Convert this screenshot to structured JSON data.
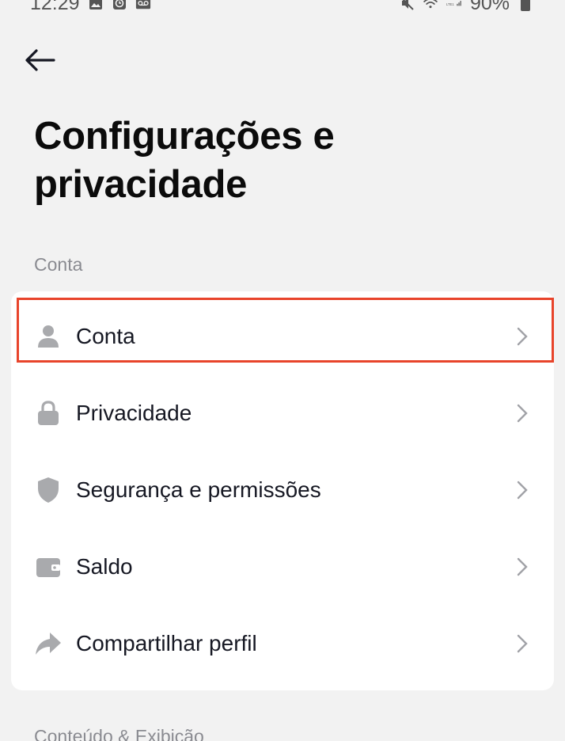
{
  "status_bar": {
    "time": "12:29",
    "battery": "90%"
  },
  "header": {
    "back_icon": "arrow-left-icon",
    "title": "Configurações e privacidade"
  },
  "sections": [
    {
      "title": "Conta",
      "items": [
        {
          "label": "Conta",
          "icon": "person-icon",
          "highlighted": true
        },
        {
          "label": "Privacidade",
          "icon": "lock-icon"
        },
        {
          "label": "Segurança e permissões",
          "icon": "shield-icon"
        },
        {
          "label": "Saldo",
          "icon": "wallet-icon"
        },
        {
          "label": "Compartilhar perfil",
          "icon": "share-arrow-icon"
        }
      ]
    },
    {
      "title": "Conteúdo & Exibição"
    }
  ],
  "colors": {
    "background": "#f2f2f2",
    "card": "#ffffff",
    "icon": "#a9aaad",
    "highlight": "#e8442b"
  }
}
